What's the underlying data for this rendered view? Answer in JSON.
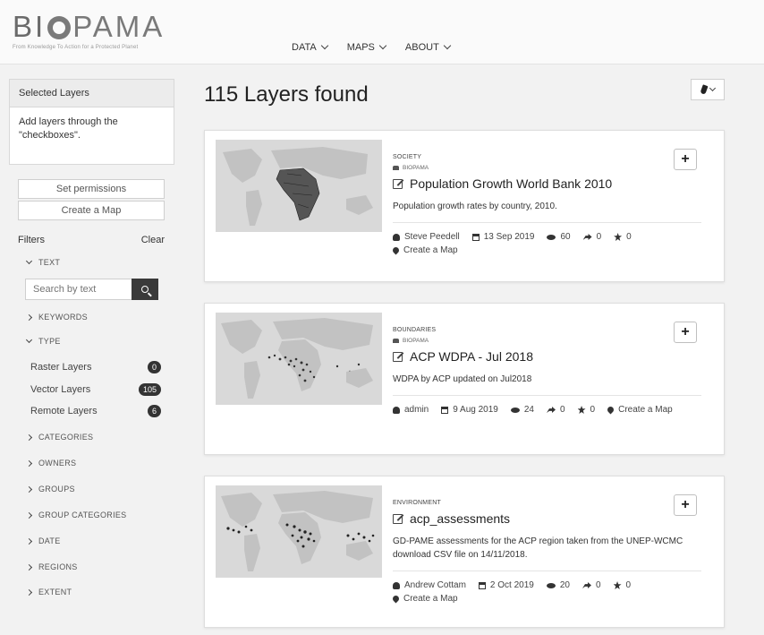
{
  "header": {
    "logo_text": "BIOPAMA",
    "tagline": "From Knowledge To Action for a Protected Planet",
    "nav": [
      {
        "label": "DATA"
      },
      {
        "label": "MAPS"
      },
      {
        "label": "ABOUT"
      }
    ]
  },
  "sidebar": {
    "selected_layers_title": "Selected Layers",
    "selected_layers_hint": "Add layers through the \"checkboxes\".",
    "set_permissions": "Set permissions",
    "create_map": "Create a Map",
    "filters_label": "Filters",
    "clear_label": "Clear",
    "facets": {
      "text": "TEXT",
      "keywords": "KEYWORDS",
      "type": "TYPE",
      "categories": "CATEGORIES",
      "owners": "OWNERS",
      "groups": "GROUPS",
      "group_categories": "GROUP CATEGORIES",
      "date": "DATE",
      "regions": "REGIONS",
      "extent": "EXTENT"
    },
    "search_placeholder": "Search by text",
    "types": [
      {
        "label": "Raster Layers",
        "count": "0"
      },
      {
        "label": "Vector Layers",
        "count": "105"
      },
      {
        "label": "Remote Layers",
        "count": "6"
      }
    ]
  },
  "main": {
    "results_title": "115 Layers found",
    "cards": [
      {
        "category": "SOCIETY",
        "group": "BIOPAMA",
        "title": "Population Growth World Bank 2010",
        "description": "Population growth rates by country, 2010.",
        "owner": "Steve Peedell",
        "date": "13 Sep 2019",
        "views": "60",
        "shares": "0",
        "rating": "0",
        "create_map": "Create a Map"
      },
      {
        "category": "BOUNDARIES",
        "group": "BIOPAMA",
        "title": "ACP WDPA - Jul 2018",
        "description": "WDPA by ACP updated on Jul2018",
        "owner": "admin",
        "date": "9 Aug 2019",
        "views": "24",
        "shares": "0",
        "rating": "0",
        "create_map": "Create a Map"
      },
      {
        "category": "ENVIRONMENT",
        "group": "",
        "title": "acp_assessments",
        "description": "GD-PAME assessments for the ACP region taken from the UNEP-WCMC download CSV file on 14/11/2018.",
        "owner": "Andrew Cottam",
        "date": "2 Oct 2019",
        "views": "20",
        "shares": "0",
        "rating": "0",
        "create_map": "Create a Map"
      }
    ]
  }
}
